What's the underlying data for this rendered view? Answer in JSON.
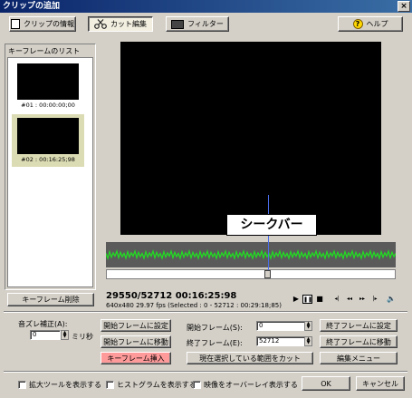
{
  "window": {
    "title": "クリップの追加",
    "close_glyph": "×"
  },
  "toolbar": {
    "clip_info": "クリップの情報",
    "cut_edit": "カット編集",
    "filter": "フィルター",
    "help": "ヘルプ",
    "help_glyph": "?"
  },
  "keyframes": {
    "label": "キーフレームのリスト",
    "items": [
      {
        "caption": "#01 : 00:00:00;00",
        "selected": false
      },
      {
        "caption": "#02 : 00:16:25;98",
        "selected": true
      }
    ],
    "delete_button": "キーフレーム削除"
  },
  "player": {
    "seek_callout": "シークバー",
    "position": "29550/52712  00:16:25:98",
    "info": "640x480 29.97 fps  (Selected : 0 - 52712 : 00:29:18;85)",
    "seek_fraction": 0.561,
    "transport": {
      "play": "▶",
      "pause": "❚❚",
      "stop": "■",
      "prev_key": "◂|",
      "rewind": "◂◂",
      "forward": "▸▸",
      "next_key": "|▸",
      "volume": "🔈"
    }
  },
  "edit": {
    "audio_offset_label": "音ズレ補正(A):",
    "audio_offset_value": "0",
    "audio_offset_unit": "ミリ秒",
    "set_start": "開始フレームに設定",
    "goto_start": "開始フレームに移動",
    "insert_keyframe": "キーフレーム挿入",
    "start_frame_label": "開始フレーム(S):",
    "start_frame_value": "0",
    "end_frame_label": "終了フレーム(E):",
    "end_frame_value": "52712",
    "cut_selection": "現在選択している範囲をカット",
    "set_end": "終了フレームに設定",
    "goto_end": "終了フレームに移動",
    "edit_menu": "編集メニュー"
  },
  "footer": {
    "show_zoom_tool": "拡大ツールを表示する",
    "show_histogram": "ヒストグラムを表示する",
    "overlay_video": "映像をオーバーレイ表示する",
    "ok": "OK",
    "cancel": "キャンセル"
  },
  "colors": {
    "waveform": "#22dd22",
    "selected_keyframe_bg": "#dcdcb4"
  }
}
